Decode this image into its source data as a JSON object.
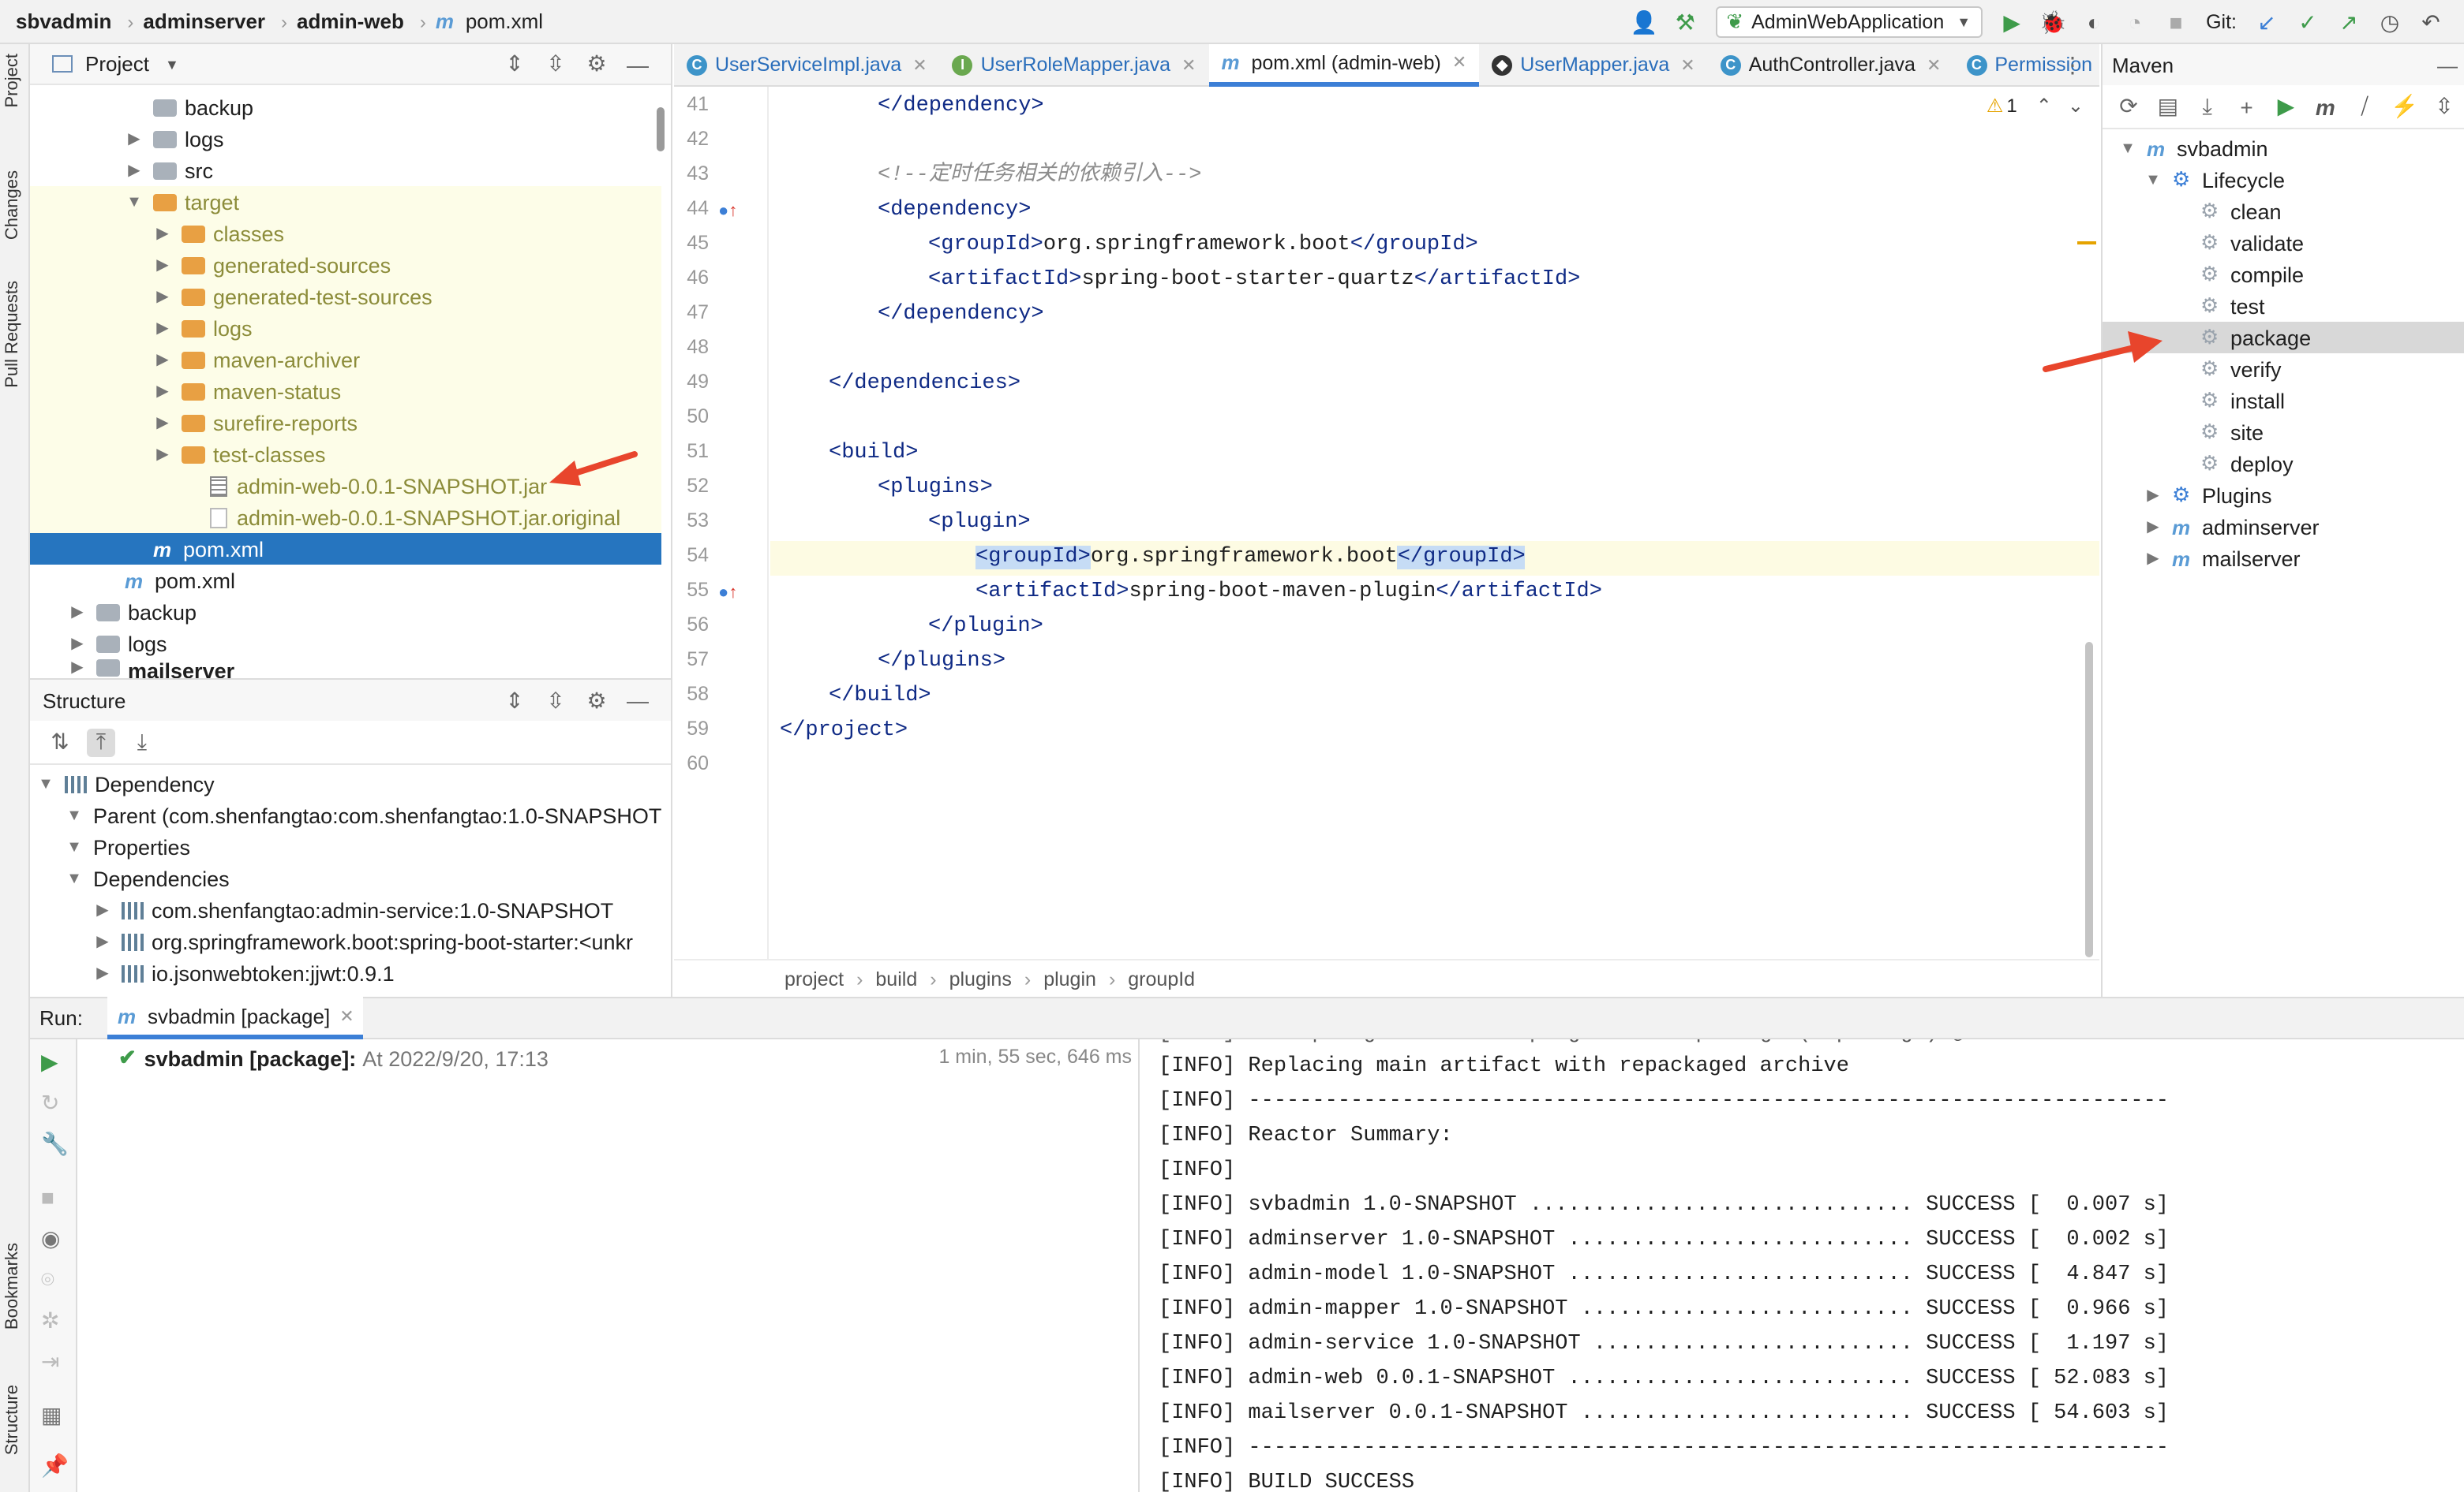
{
  "navbar": {
    "crumbs": [
      "sbvadmin",
      "adminserver",
      "admin-web",
      "pom.xml"
    ],
    "run_config": "AdminWebApplication",
    "git_label": "Git:"
  },
  "left_strip": {
    "project": "Project",
    "changes": "Changes",
    "pull_requests": "Pull Requests",
    "bookmarks": "Bookmarks",
    "structure": "Structure"
  },
  "project_pane": {
    "title": "Project",
    "items": [
      {
        "label": "backup",
        "icon": "folder-gray"
      },
      {
        "label": "logs",
        "icon": "folder-gray"
      },
      {
        "label": "src",
        "icon": "folder-gray"
      },
      {
        "label": "target",
        "icon": "folder-orange"
      },
      {
        "label": "classes",
        "icon": "folder-orange"
      },
      {
        "label": "generated-sources",
        "icon": "folder-orange"
      },
      {
        "label": "generated-test-sources",
        "icon": "folder-orange"
      },
      {
        "label": "logs",
        "icon": "folder-orange"
      },
      {
        "label": "maven-archiver",
        "icon": "folder-orange"
      },
      {
        "label": "maven-status",
        "icon": "folder-orange"
      },
      {
        "label": "surefire-reports",
        "icon": "folder-orange"
      },
      {
        "label": "test-classes",
        "icon": "folder-orange"
      },
      {
        "label": "admin-web-0.0.1-SNAPSHOT.jar",
        "icon": "jar-icon"
      },
      {
        "label": "admin-web-0.0.1-SNAPSHOT.jar.original",
        "icon": "file-icon"
      },
      {
        "label": "pom.xml",
        "icon": "maven-file-icon"
      },
      {
        "label": "pom.xml",
        "icon": "maven-file-icon"
      },
      {
        "label": "backup",
        "icon": "folder-gray"
      },
      {
        "label": "logs",
        "icon": "folder-gray"
      },
      {
        "label": "mailserver",
        "icon": "folder-gray"
      }
    ]
  },
  "structure_pane": {
    "title": "Structure",
    "items": [
      "Dependency",
      "Parent (com.shenfangtao:com.shenfangtao:1.0-SNAPSHOT",
      "Properties",
      "Dependencies",
      "com.shenfangtao:admin-service:1.0-SNAPSHOT",
      "org.springframework.boot:spring-boot-starter:<unkr",
      "io.jsonwebtoken:jjwt:0.9.1"
    ]
  },
  "editor": {
    "tabs": [
      {
        "label": "UserServiceImpl.java",
        "icon": "C"
      },
      {
        "label": "UserRoleMapper.java",
        "icon": "I"
      },
      {
        "label": "pom.xml (admin-web)",
        "icon": "m"
      },
      {
        "label": "UserMapper.java",
        "icon": "mybatis"
      },
      {
        "label": "AuthController.java",
        "icon": "C"
      },
      {
        "label": "Permission",
        "icon": "C"
      }
    ],
    "warning_count": "1",
    "line_numbers": [
      "41",
      "42",
      "43",
      "44",
      "45",
      "46",
      "47",
      "48",
      "49",
      "50",
      "51",
      "52",
      "53",
      "54",
      "55",
      "56",
      "57",
      "58",
      "59",
      "60"
    ],
    "comment": "<!--定时任务相关的依赖引入-->",
    "tags": {
      "dependency_close": "</dependency>",
      "dependency_open": "<dependency>",
      "groupId_open": "<groupId>",
      "groupId_close": "</groupId>",
      "artifactId_open": "<artifactId>",
      "artifactId_close": "</artifactId>",
      "dependencies_close": "</dependencies>",
      "build_open": "<build>",
      "plugins_open": "<plugins>",
      "plugin_open": "<plugin>",
      "plugin_close": "</plugin>",
      "plugins_close": "</plugins>",
      "build_close": "</build>",
      "project_close": "</project>"
    },
    "values": {
      "group_boot": "org.springframework.boot",
      "quartz": "spring-boot-starter-quartz",
      "maven_plugin": "spring-boot-maven-plugin"
    },
    "breadcrumb": [
      "project",
      "build",
      "plugins",
      "plugin",
      "groupId"
    ]
  },
  "maven_pane": {
    "title": "Maven",
    "root": "svbadmin",
    "lifecycle": "Lifecycle",
    "phases": [
      "clean",
      "validate",
      "compile",
      "test",
      "package",
      "verify",
      "install",
      "site",
      "deploy"
    ],
    "plugins": "Plugins",
    "modules": [
      "adminserver",
      "mailserver"
    ]
  },
  "run_panel": {
    "label": "Run:",
    "tab": "svbadmin [package]",
    "task_name": "svbadmin [package]:",
    "task_time": "At 2022/9/20, 17:13",
    "duration": "1 min, 55 sec, 646 ms",
    "console_lines": [
      "[INFO] Replacing main artifact with repackaged archive",
      "[INFO] ------------------------------------------------------------------------",
      "[INFO] Reactor Summary:",
      "[INFO]",
      "[INFO] svbadmin 1.0-SNAPSHOT .............................. SUCCESS [  0.007 s]",
      "[INFO] adminserver 1.0-SNAPSHOT ........................... SUCCESS [  0.002 s]",
      "[INFO] admin-model 1.0-SNAPSHOT ........................... SUCCESS [  4.847 s]",
      "[INFO] admin-mapper 1.0-SNAPSHOT .......................... SUCCESS [  0.966 s]",
      "[INFO] admin-service 1.0-SNAPSHOT ......................... SUCCESS [  1.197 s]",
      "[INFO] admin-web 0.0.1-SNAPSHOT ........................... SUCCESS [ 52.083 s]",
      "[INFO] mailserver 0.0.1-SNAPSHOT .......................... SUCCESS [ 54.603 s]",
      "[INFO] ------------------------------------------------------------------------",
      "[INFO] BUILD SUCCESS"
    ]
  },
  "colors": {
    "accent": "#2675bf",
    "annotation_arrow": "#e8452c",
    "success": "#3e9b4a"
  }
}
